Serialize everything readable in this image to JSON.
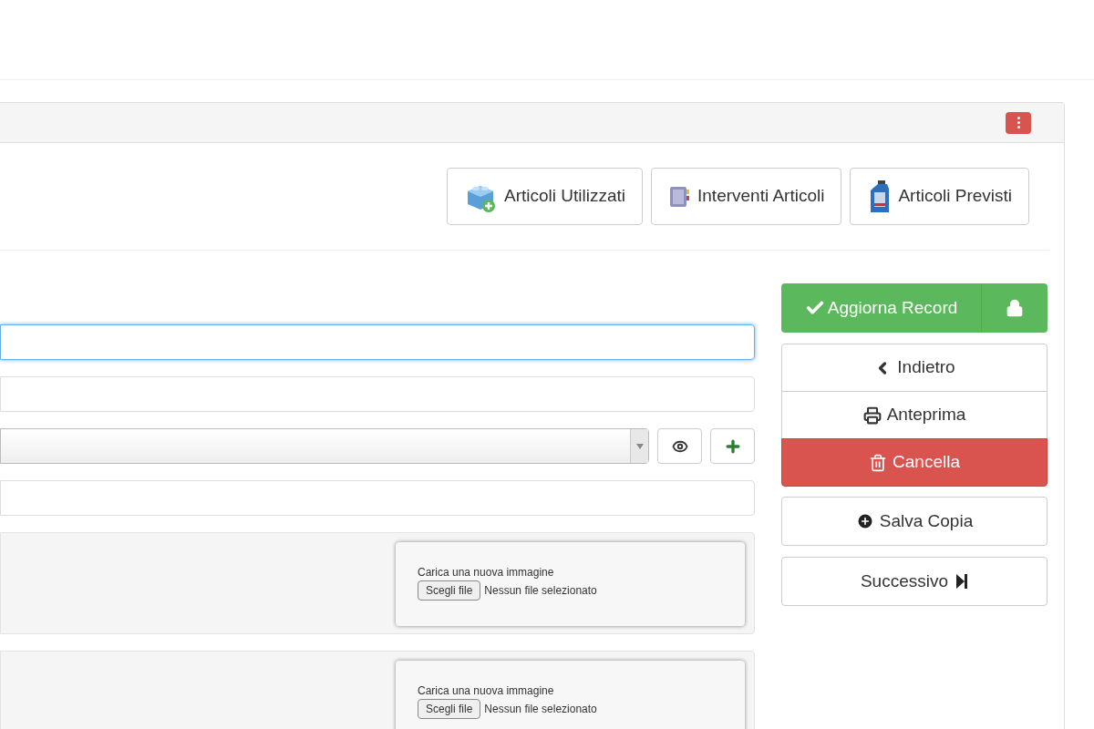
{
  "toolbar": [
    {
      "kind": "block",
      "label": "Articoli Utilizzati"
    },
    {
      "kind": "book",
      "label": "Interventi Articoli"
    },
    {
      "kind": "bottle",
      "label": "Articoli Previsti"
    }
  ],
  "fields": [
    {
      "kind": "text",
      "focused": true
    },
    {
      "kind": "text",
      "focused": false
    },
    {
      "kind": "select",
      "focused": false
    },
    {
      "kind": "text",
      "focused": false
    }
  ],
  "uploads": [
    {
      "caption": "Carica una nuova immagine",
      "button": "Scegli file",
      "status": "Nessun file selezionato"
    },
    {
      "caption": "Carica una nuova immagine",
      "button": "Scegli file",
      "status": "Nessun file selezionato"
    }
  ],
  "actions": {
    "primary": "Aggiorna Record",
    "group": [
      {
        "kind": "back",
        "label": "Indietro"
      },
      {
        "kind": "print",
        "label": "Anteprima"
      },
      {
        "kind": "delete",
        "label": "Cancella"
      }
    ],
    "copy": "Salva Copia",
    "next": "Successivo"
  }
}
